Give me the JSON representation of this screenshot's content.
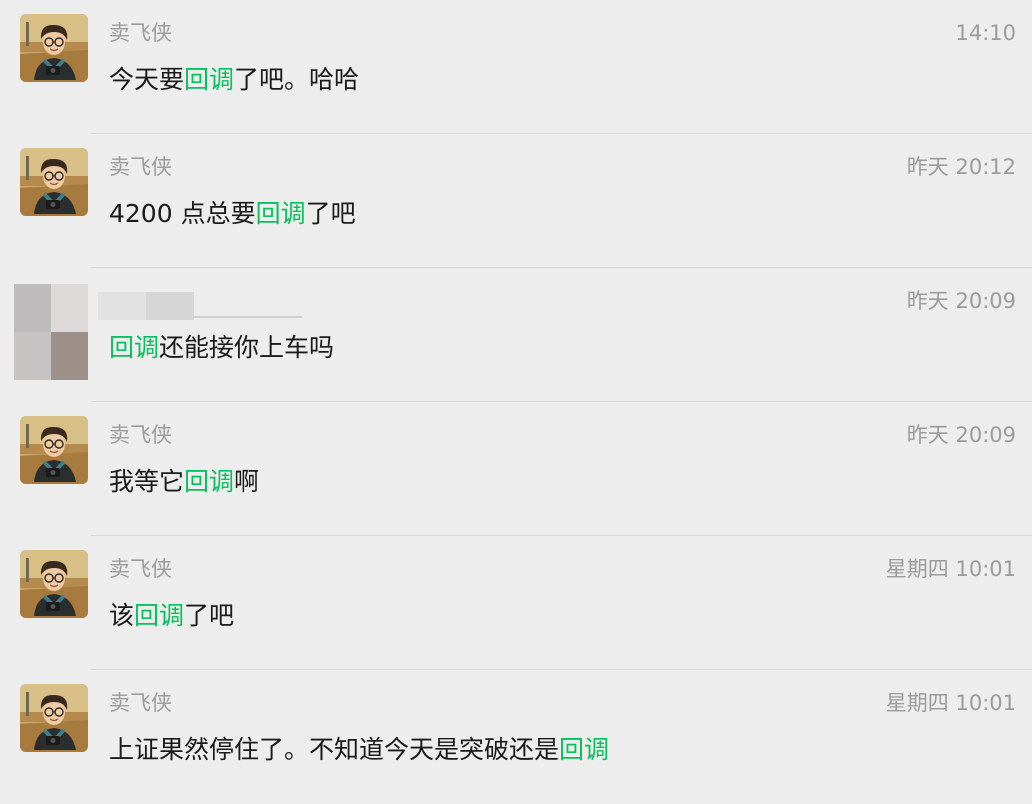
{
  "messages": [
    {
      "sender": "卖飞侠",
      "time": "14:10",
      "segments": [
        {
          "text": "今天要",
          "highlight": false
        },
        {
          "text": "回调",
          "highlight": true
        },
        {
          "text": "了吧。哈哈",
          "highlight": false
        }
      ]
    },
    {
      "sender": "卖飞侠",
      "time": "昨天 20:12",
      "segments": [
        {
          "text": "4200 点总要",
          "highlight": false
        },
        {
          "text": "回调",
          "highlight": true
        },
        {
          "text": "了吧",
          "highlight": false
        }
      ]
    },
    {
      "sender": "",
      "time": "昨天 20:09",
      "segments": [
        {
          "text": "回调",
          "highlight": true
        },
        {
          "text": "还能接你上车吗",
          "highlight": false
        }
      ]
    },
    {
      "sender": "卖飞侠",
      "time": "昨天 20:09",
      "segments": [
        {
          "text": "我等它",
          "highlight": false
        },
        {
          "text": "回调",
          "highlight": true
        },
        {
          "text": "啊",
          "highlight": false
        }
      ]
    },
    {
      "sender": "卖飞侠",
      "time": "星期四 10:01",
      "segments": [
        {
          "text": "该",
          "highlight": false
        },
        {
          "text": "回调",
          "highlight": true
        },
        {
          "text": "了吧",
          "highlight": false
        }
      ]
    },
    {
      "sender": "卖飞侠",
      "time": "星期四 10:01",
      "segments": [
        {
          "text": "上证果然停住了。不知道今天是突破还是",
          "highlight": false
        },
        {
          "text": "回调",
          "highlight": true
        }
      ]
    }
  ],
  "colors": {
    "background": "#ededed",
    "highlight": "#07c160",
    "meta_text": "#9b9b9b",
    "body_text": "#1a1a1a",
    "divider": "#d9d9d9"
  }
}
